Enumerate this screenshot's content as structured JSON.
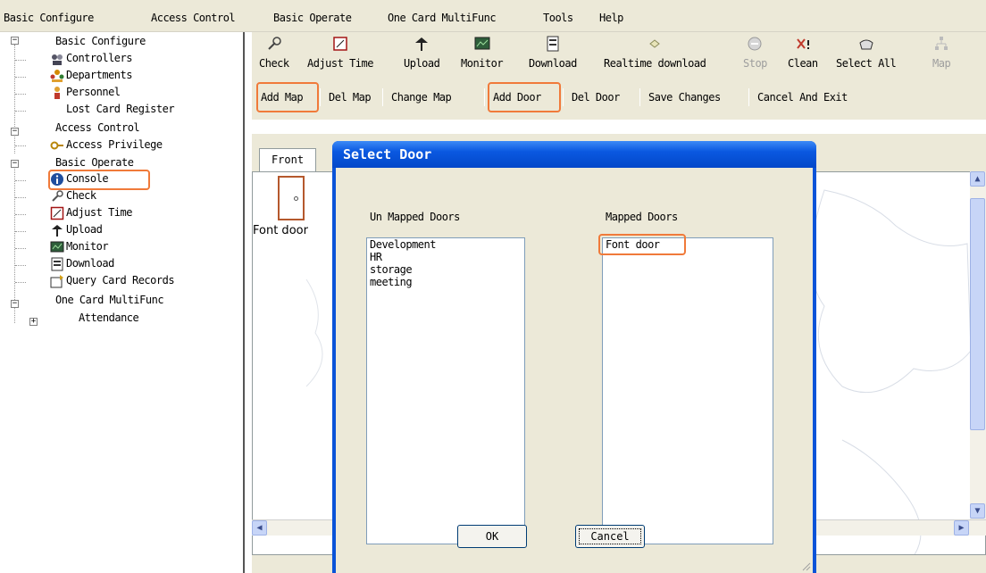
{
  "menu": [
    {
      "label": "Basic Configure"
    },
    {
      "label": "Access Control"
    },
    {
      "label": "Basic Operate"
    },
    {
      "label": "One Card MultiFunc"
    },
    {
      "label": "Tools"
    },
    {
      "label": "Help"
    }
  ],
  "tree": {
    "basic_configure": "Basic Configure",
    "controllers": "Controllers",
    "departments": "Departments",
    "personnel": "Personnel",
    "lost_card_register": "Lost Card Register",
    "access_control": "Access Control",
    "access_privilege": "Access Privilege",
    "basic_operate": "Basic Operate",
    "console": "Console",
    "check": "Check",
    "adjust_time": "Adjust Time",
    "upload": "Upload",
    "monitor": "Monitor",
    "download": "Download",
    "query_card_records": "Query Card Records",
    "one_card_multifunc": "One Card MultiFunc",
    "attendance": "Attendance"
  },
  "toolbar": {
    "check": "Check",
    "adjust_time": "Adjust Time",
    "upload": "Upload",
    "monitor": "Monitor",
    "download": "Download",
    "realtime_download": "Realtime download",
    "stop": "Stop",
    "clean": "Clean",
    "select_all": "Select All",
    "map": "Map"
  },
  "map_edit": {
    "add_map": "Add Map",
    "del_map": "Del Map",
    "change_map": "Change Map",
    "add_door": "Add Door",
    "del_door": "Del Door",
    "save_changes": "Save Changes",
    "cancel_and_exit": "Cancel And Exit"
  },
  "map_tab": {
    "label": "Front",
    "door_label": "Font door"
  },
  "dialog": {
    "title": "Select Door",
    "unmapped_label": "Un Mapped Doors",
    "mapped_label": "Mapped Doors",
    "unmapped_doors": [
      "Development",
      "HR",
      "storage",
      "meeting"
    ],
    "mapped_doors": [
      "Font door"
    ],
    "ok": "OK",
    "cancel": "Cancel"
  },
  "colors": {
    "highlight": "#f07a3a",
    "titlebar": "#0a58e0",
    "chrome": "#ece9d8"
  }
}
